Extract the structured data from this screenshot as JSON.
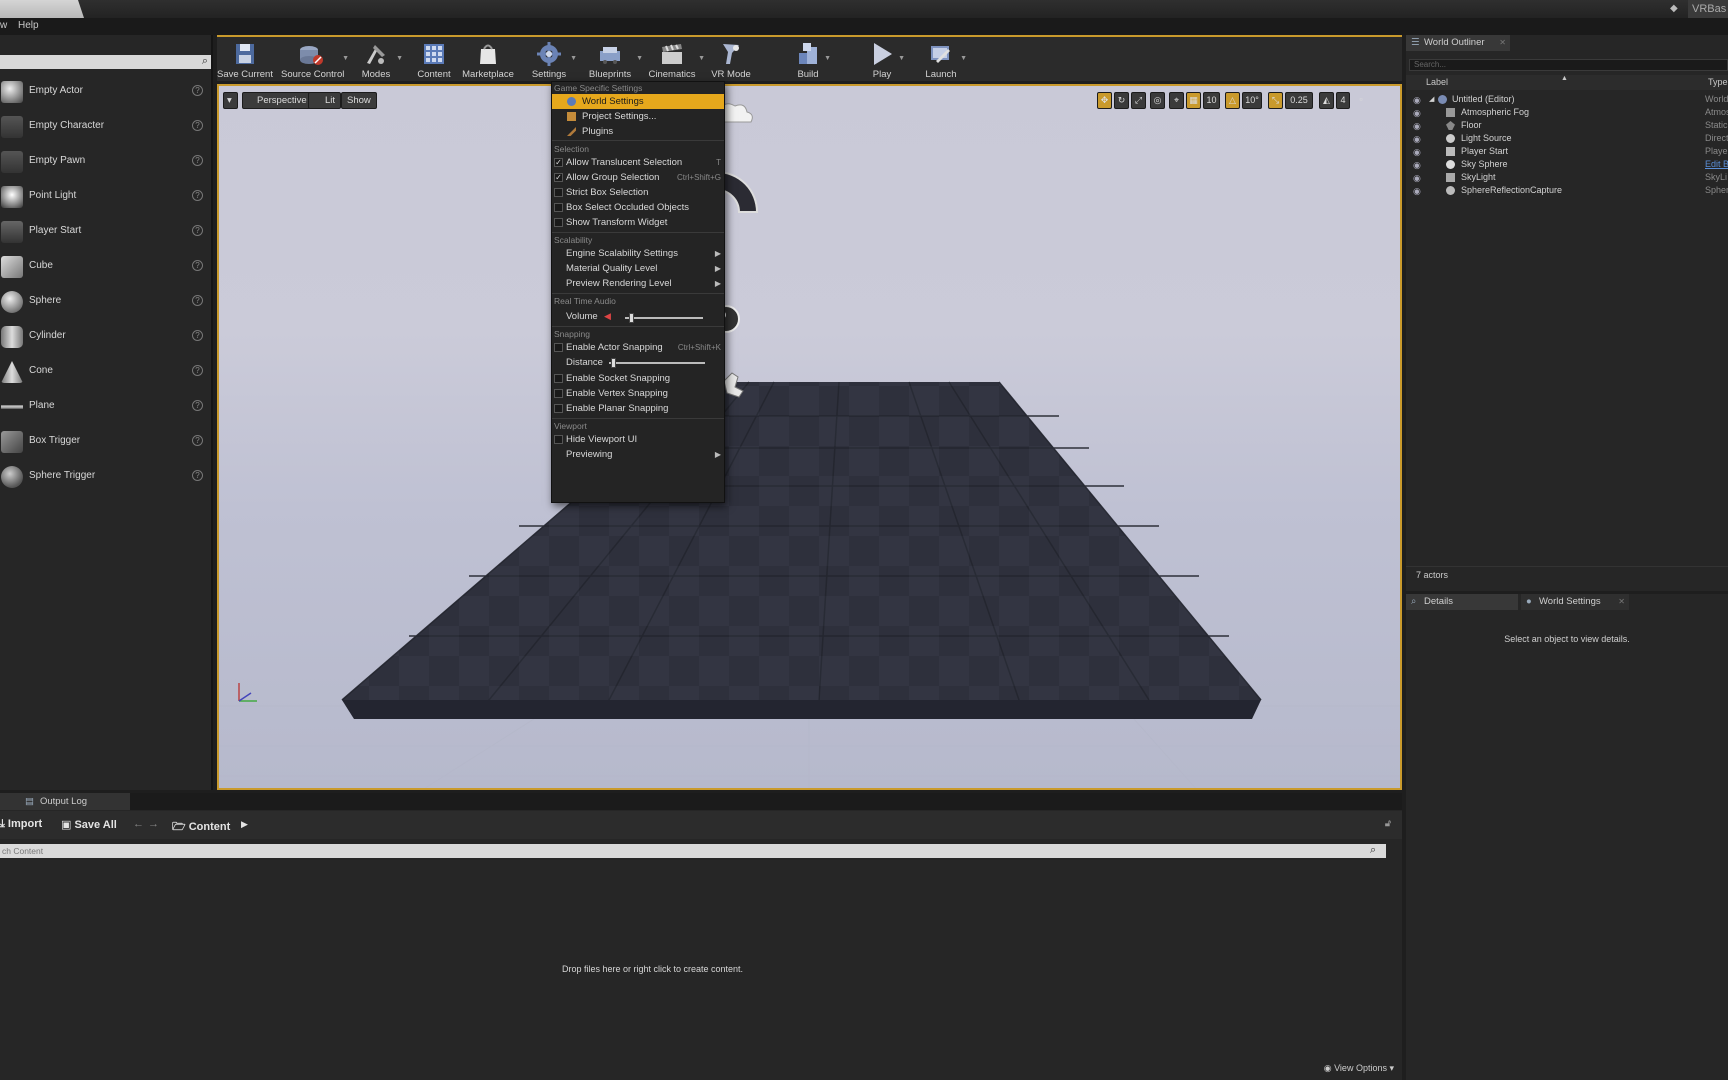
{
  "titlebar": {
    "project": "VRBas"
  },
  "menubar": {
    "items": [
      "w",
      "Help"
    ]
  },
  "place_panel": {
    "items": [
      {
        "label": "Empty Actor"
      },
      {
        "label": "Empty Character"
      },
      {
        "label": "Empty Pawn"
      },
      {
        "label": "Point Light"
      },
      {
        "label": "Player Start"
      },
      {
        "label": "Cube"
      },
      {
        "label": "Sphere"
      },
      {
        "label": "Cylinder"
      },
      {
        "label": "Cone"
      },
      {
        "label": "Plane"
      },
      {
        "label": "Box Trigger"
      },
      {
        "label": "Sphere Trigger"
      }
    ],
    "help_glyph": "?"
  },
  "toolbar": {
    "save_current": "Save Current",
    "source_control": "Source Control",
    "modes": "Modes",
    "content": "Content",
    "marketplace": "Marketplace",
    "settings": "Settings",
    "blueprints": "Blueprints",
    "cinematics": "Cinematics",
    "vr_mode": "VR Mode",
    "build": "Build",
    "play": "Play",
    "launch": "Launch"
  },
  "viewport": {
    "perspective": "Perspective",
    "lit": "Lit",
    "show": "Show",
    "grid_snap": "10",
    "rot_snap": "10°",
    "scale_snap": "0.25",
    "cam_speed": "4"
  },
  "settings_menu": {
    "sections": {
      "game": "Game Specific Settings",
      "selection": "Selection",
      "scalability": "Scalability",
      "audio": "Real Time Audio",
      "snapping": "Snapping",
      "viewport": "Viewport"
    },
    "world_settings": "World Settings",
    "project_settings": "Project Settings...",
    "plugins": "Plugins",
    "allow_translucent": "Allow Translucent Selection",
    "allow_translucent_sc": "T",
    "allow_group": "Allow Group Selection",
    "allow_group_sc": "Ctrl+Shift+G",
    "strict_box": "Strict Box Selection",
    "box_occluded": "Box Select Occluded Objects",
    "show_transform": "Show Transform Widget",
    "engine_scalability": "Engine Scalability Settings",
    "material_quality": "Material Quality Level",
    "preview_rendering": "Preview Rendering Level",
    "volume": "Volume",
    "volume_level": 0.05,
    "enable_actor_snapping": "Enable Actor Snapping",
    "enable_actor_snapping_sc": "Ctrl+Shift+K",
    "distance": "Distance",
    "distance_level": 0.02,
    "enable_socket": "Enable Socket Snapping",
    "enable_vertex": "Enable Vertex Snapping",
    "enable_planar": "Enable Planar Snapping",
    "hide_viewport_ui": "Hide Viewport UI",
    "previewing": "Previewing",
    "checked_glyph": "✓"
  },
  "outliner": {
    "tab": "World Outliner",
    "search_placeholder": "Search...",
    "col_label": "Label",
    "col_type": "Type",
    "rows": [
      {
        "name": "Untitled (Editor)",
        "type": "World"
      },
      {
        "name": "Atmospheric Fog",
        "type": "Atmos"
      },
      {
        "name": "Floor",
        "type": "Static"
      },
      {
        "name": "Light Source",
        "type": "Direct"
      },
      {
        "name": "Player Start",
        "type": "Player"
      },
      {
        "name": "Sky Sphere",
        "type": "Edit B"
      },
      {
        "name": "SkyLight",
        "type": "SkyLi"
      },
      {
        "name": "SphereReflectionCapture",
        "type": "Spher"
      }
    ],
    "count": "7 actors"
  },
  "details": {
    "tab_details": "Details",
    "tab_world_settings": "World Settings",
    "message": "Select an object to view details."
  },
  "content_browser": {
    "tab": "Output Log",
    "import": "Import",
    "save_all": "Save All",
    "path": "Content",
    "search_placeholder": "ch Content",
    "drop_message": "Drop files here or right click to create content.",
    "view_options": "View Options"
  },
  "colors": {
    "accent": "#e6a81c",
    "frame": "#c99a2c"
  }
}
